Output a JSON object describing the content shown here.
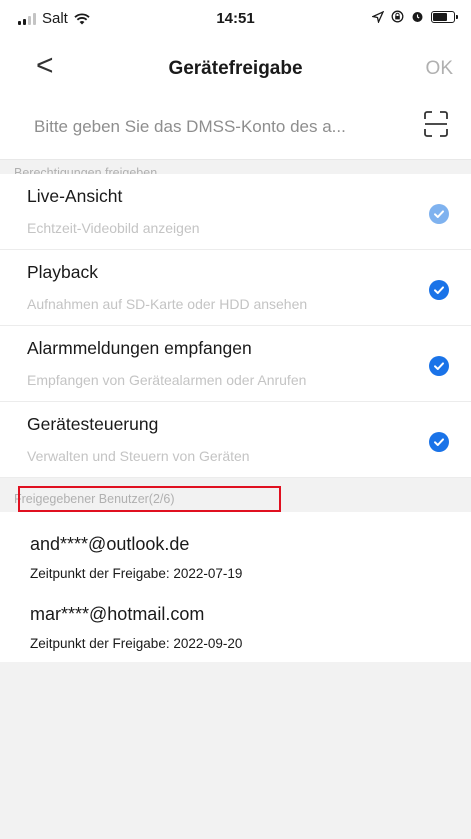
{
  "status_bar": {
    "carrier": "Salt",
    "time": "14:51",
    "wifi_icon": "wifi-icon",
    "battery_level": 0.7
  },
  "nav": {
    "back": "<",
    "title": "Gerätefreigabe",
    "ok": "OK"
  },
  "search": {
    "placeholder": "Bitte geben Sie das DMSS-Konto des a...",
    "value": "",
    "icon": "scan-icon"
  },
  "permissions": {
    "header": "Berechtigungen freigeben",
    "items": [
      {
        "title": "Live-Ansicht",
        "subtitle": "Echtzeit-Videobild anzeigen",
        "checked": true,
        "disabled": true
      },
      {
        "title": "Playback",
        "subtitle": "Aufnahmen auf SD-Karte oder HDD ansehen",
        "checked": true,
        "disabled": false
      },
      {
        "title": "Alarmmeldungen empfangen",
        "subtitle": "Empfangen von Gerätealarmen oder Anrufen",
        "checked": true,
        "disabled": false
      },
      {
        "title": "Gerätesteuerung",
        "subtitle": "Verwalten und Steuern von Geräten",
        "checked": true,
        "disabled": false
      }
    ]
  },
  "shared_users": {
    "header": "Freigegebener Benutzer(2/6)",
    "items": [
      {
        "email": "and****@outlook.de",
        "date": "Zeitpunkt der Freigabe: 2022-07-19"
      },
      {
        "email": "mar****@hotmail.com",
        "date": "Zeitpunkt der Freigabe: 2022-09-20"
      }
    ]
  },
  "colors": {
    "check_active": "#1a73e8",
    "check_disabled": "#7fb2ef",
    "highlight_box": "#e01020"
  }
}
